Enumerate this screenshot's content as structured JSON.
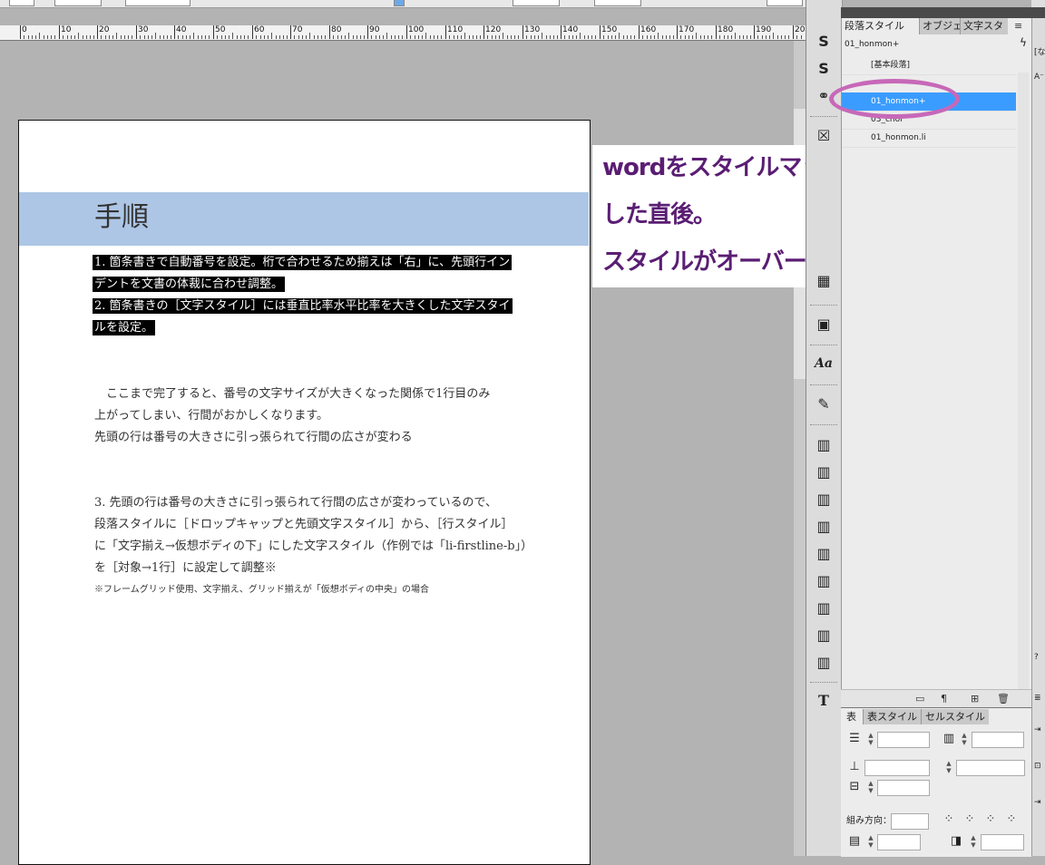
{
  "ruler": {
    "labels": [
      "0",
      "10",
      "20",
      "30",
      "40",
      "50",
      "60",
      "70",
      "80",
      "90",
      "100",
      "110",
      "120",
      "130",
      "140",
      "150",
      "160",
      "170",
      "180",
      "190",
      "20"
    ]
  },
  "document": {
    "heading": "手順",
    "highlighted_lines": [
      "1. 箇条書きで自動番号を設定。桁で合わせるため揃えは「右」に、先頭行イン",
      "デントを文書の体裁に合わせ調整。",
      "2. 箇条書きの［文字スタイル］には垂直比率水平比率を大きくした文字スタイ",
      "ルを設定。"
    ],
    "paragraph1": [
      "　ここまで完了すると、番号の文字サイズが大きくなった関係で1行目のみ",
      "上がってしまい、行間がおかしくなります。",
      "先頭の行は番号の大きさに引っ張られて行間の広さが変わる"
    ],
    "paragraph2": [
      "3. 先頭の行は番号の大きさに引っ張られて行間の広さが変わっているので、",
      "段落スタイルに［ドロップキャップと先頭文字スタイル］から、［行スタイル］",
      "に「文字揃え→仮想ボディの下」にした文字スタイル（作例では「li-firstline-b」）",
      "を［対象→1行］に設定して調整※"
    ],
    "footnote": "※フレームグリッド使用、文字揃え、グリッド揃えが「仮想ボディの中央」の場合"
  },
  "annotation": {
    "lines": [
      "wordをスタイルマッピングして配置",
      "した直後。",
      "スタイルがオーバーライドしている。"
    ],
    "color": "#5a1d73"
  },
  "paragraph_styles_panel": {
    "tabs": [
      "段落スタイル",
      "オブジェ",
      "文字スタ"
    ],
    "current_style": "01_honmon+",
    "items": [
      "[基本段落]",
      "01_honmon+",
      "03_chor",
      "01_honmon.li"
    ],
    "selected_index": 1,
    "selection_color": "#3b9cff",
    "circle_color": "#c768b8"
  },
  "table_panel": {
    "tabs": [
      "表",
      "表スタイル",
      "セルスタイル"
    ],
    "direction_label": "組み方向："
  },
  "tools": {
    "icons": [
      "swatch-s-icon",
      "swatch-s2-icon",
      "link-icon",
      "frame-icon",
      "image-icon",
      "paragraph-icon",
      "char-styles-aa-icon",
      "edit-note-icon",
      "book-icon",
      "book-icon",
      "book-icon",
      "book-icon",
      "book-icon",
      "book-icon",
      "book-icon",
      "book-icon",
      "book-icon",
      "text-tool-icon"
    ],
    "aa_label": "Aa",
    "t_label": "T"
  }
}
